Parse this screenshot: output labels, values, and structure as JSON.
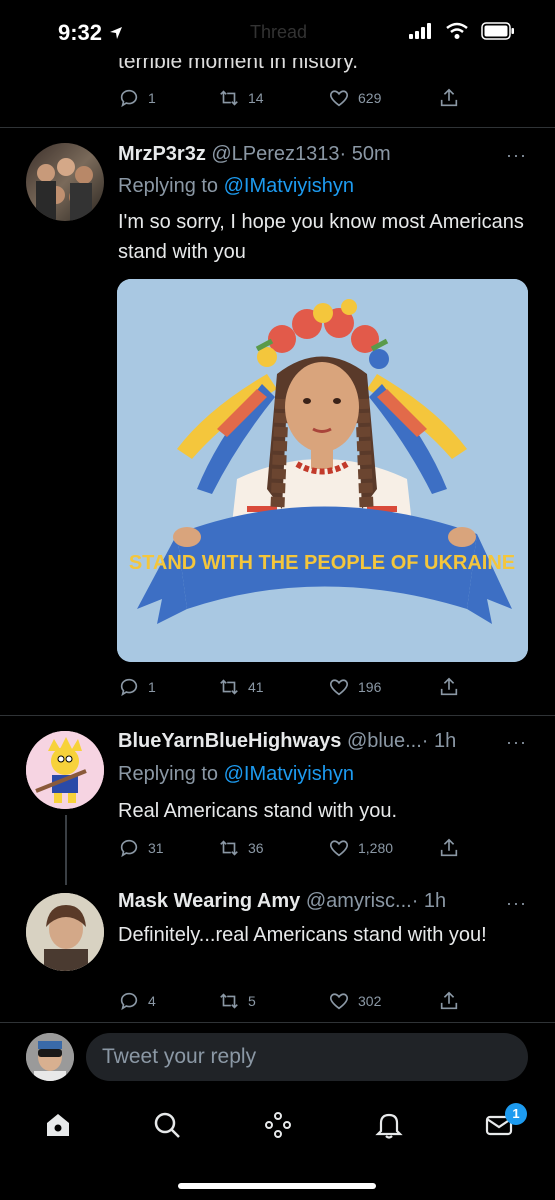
{
  "status_bar": {
    "time": "9:32",
    "ghost_title": "Thread"
  },
  "previous_tweet": {
    "tail_text": "terrible moment in history.",
    "replies": "1",
    "retweets": "14",
    "likes": "629"
  },
  "tweets": [
    {
      "name": "MrzP3r3z",
      "handle": "@LPerez1313",
      "time": "· 50m",
      "replying_prefix": "Replying to",
      "replying_to": "@IMatviyishyn",
      "text": "I'm so sorry, I hope you know most Americans stand with you",
      "media_banner_text": "STAND WITH THE PEOPLE OF UKRAINE",
      "replies": "1",
      "retweets": "41",
      "likes": "196"
    },
    {
      "name": "BlueYarnBlueHighways",
      "handle": "@blue...",
      "time": "· 1h",
      "replying_prefix": "Replying to",
      "replying_to": "@IMatviyishyn",
      "text": "Real Americans stand with you.",
      "replies": "31",
      "retweets": "36",
      "likes": "1,280"
    },
    {
      "name": "Mask Wearing Amy",
      "handle": "@amyrisc...",
      "time": "· 1h",
      "text": "Definitely...real Americans stand with you!",
      "replies": "4",
      "retweets": "5",
      "likes": "302"
    }
  ],
  "more_label": "···",
  "reply_box": {
    "placeholder": "Tweet your reply"
  },
  "nav": {
    "messages_badge": "1"
  },
  "colors": {
    "accent": "#1d9bf0",
    "background": "#000000",
    "muted": "#8b98a5"
  }
}
